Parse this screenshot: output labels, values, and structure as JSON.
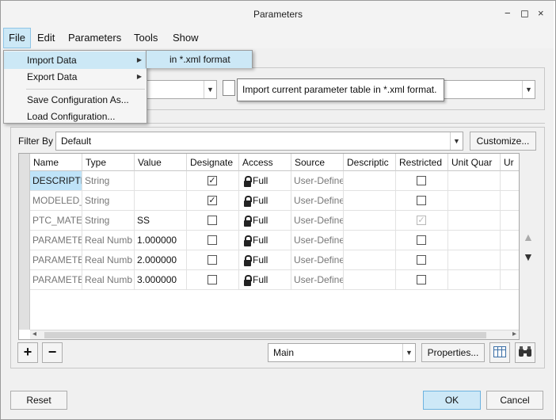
{
  "window": {
    "title": "Parameters",
    "minimize": "−",
    "maximize": "◻",
    "close": "×"
  },
  "menubar": {
    "file": "File",
    "edit": "Edit",
    "parameters": "Parameters",
    "tools": "Tools",
    "show": "Show"
  },
  "file_menu": {
    "import_data": "Import Data",
    "export_data": "Export Data",
    "save_config": "Save Configuration As...",
    "load_config": "Load Configuration...",
    "submenu_arrow": "▶"
  },
  "import_submenu": {
    "xml": "in *.xml format"
  },
  "tooltip": "Import current parameter table in *.xml format.",
  "filter": {
    "label": "Filter By",
    "value": "Default",
    "customize": "Customize..."
  },
  "table": {
    "headers": [
      "Name",
      "Type",
      "Value",
      "Designate",
      "Access",
      "Source",
      "Descriptic",
      "Restricted",
      "Unit Quar",
      "Ur"
    ],
    "rows": [
      {
        "name": "DESCRIPTIC",
        "type": "String",
        "value": "",
        "designate": true,
        "access": "Full",
        "source": "User-Define",
        "restricted": false
      },
      {
        "name": "MODELED_",
        "type": "String",
        "value": "",
        "designate": true,
        "access": "Full",
        "source": "User-Define",
        "restricted": false
      },
      {
        "name": "PTC_MATE",
        "type": "String",
        "value": "SS",
        "designate": false,
        "access": "Full",
        "source": "User-Define",
        "restricted": true
      },
      {
        "name": "PARAMETE",
        "type": "Real Numb",
        "value": "1.000000",
        "designate": false,
        "access": "Full",
        "source": "User-Define",
        "restricted": false
      },
      {
        "name": "PARAMETE",
        "type": "Real Numb",
        "value": "2.000000",
        "designate": false,
        "access": "Full",
        "source": "User-Define",
        "restricted": false
      },
      {
        "name": "PARAMETE",
        "type": "Real Numb",
        "value": "3.000000",
        "designate": false,
        "access": "Full",
        "source": "User-Define",
        "restricted": false
      }
    ]
  },
  "bottom": {
    "add": "+",
    "remove": "−",
    "main_value": "Main",
    "properties": "Properties...",
    "up": "▲",
    "down": "▼"
  },
  "footer": {
    "reset": "Reset",
    "ok": "OK",
    "cancel": "Cancel"
  },
  "check_mark": "✓",
  "combo_arrow": "▼",
  "scroll_left": "◂",
  "scroll_right": "▸",
  "colors": {
    "accent": "#cce8f6",
    "selection": "#bfe3f8"
  }
}
